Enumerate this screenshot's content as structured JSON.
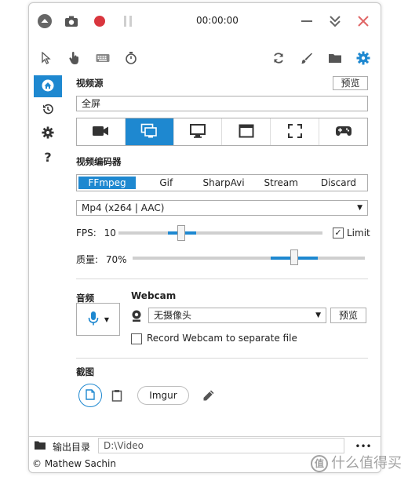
{
  "titlebar": {
    "timer": "00:00:00"
  },
  "toolbar": {},
  "sidebar": {
    "items": [
      {
        "name": "home",
        "active": true
      },
      {
        "name": "history",
        "active": false
      },
      {
        "name": "settings",
        "active": false
      },
      {
        "name": "help",
        "label": "?",
        "active": false
      }
    ]
  },
  "video_source": {
    "label": "视频源",
    "preview_label": "预览",
    "value": "全屏",
    "sources": [
      "camera",
      "screen",
      "monitor",
      "window",
      "region",
      "game"
    ],
    "active_index": 1
  },
  "encoder": {
    "label": "视频编码器",
    "options": [
      "FFmpeg",
      "Gif",
      "SharpAvi",
      "Stream",
      "Discard"
    ],
    "active_index": 0,
    "format_value": "Mp4 (x264 | AAC)",
    "fps_label": "FPS:",
    "fps_value": "10",
    "limit_label": "Limit",
    "limit_checked": true,
    "quality_label": "质量:",
    "quality_value": "70%"
  },
  "audio": {
    "label": "音频"
  },
  "webcam": {
    "label": "Webcam",
    "value": "无摄像头",
    "preview_label": "预览",
    "separate_label": "Record Webcam to separate file",
    "separate_checked": false
  },
  "screenshot": {
    "label": "截图",
    "imgur_label": "Imgur"
  },
  "output": {
    "label": "输出目录",
    "path": "D:\\Video",
    "more_label": "•••"
  },
  "footer": {
    "credit": "© Mathew Sachin"
  },
  "watermark": {
    "text": "什么值得买",
    "badge": "值"
  },
  "colors": {
    "accent": "#1e88d0",
    "record": "#d9363e",
    "close": "#e06666"
  }
}
